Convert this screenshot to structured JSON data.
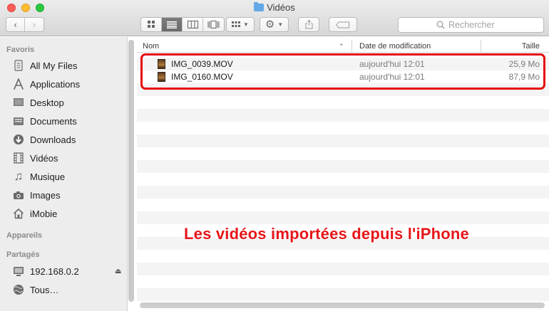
{
  "window": {
    "title": "Vidéos"
  },
  "toolbar": {
    "search_placeholder": "Rechercher"
  },
  "sidebar": {
    "sections": {
      "favorites": "Favoris",
      "devices": "Appareils",
      "shared": "Partagés"
    },
    "favorites": [
      {
        "label": "All My Files",
        "icon": "all-files-icon"
      },
      {
        "label": "Applications",
        "icon": "applications-icon"
      },
      {
        "label": "Desktop",
        "icon": "desktop-icon"
      },
      {
        "label": "Documents",
        "icon": "documents-icon"
      },
      {
        "label": "Downloads",
        "icon": "downloads-icon"
      },
      {
        "label": "Vidéos",
        "icon": "film-icon"
      },
      {
        "label": "Musique",
        "icon": "music-icon"
      },
      {
        "label": "Images",
        "icon": "camera-icon"
      },
      {
        "label": "iMobie",
        "icon": "home-icon"
      }
    ],
    "shared": [
      {
        "label": "192.168.0.2",
        "icon": "computer-icon"
      },
      {
        "label": "Tous…",
        "icon": "globe-icon"
      }
    ]
  },
  "list": {
    "columns": {
      "name": "Nom",
      "date": "Date de modification",
      "size": "Taille"
    },
    "files": [
      {
        "name": "IMG_0039.MOV",
        "date": "aujourd'hui 12:01",
        "size": "25,9 Mo"
      },
      {
        "name": "IMG_0160.MOV",
        "date": "aujourd'hui 12:01",
        "size": "87,9 Mo"
      }
    ]
  },
  "annotation": {
    "text": "Les vidéos importées depuis l'iPhone",
    "color": "#e6161a"
  }
}
